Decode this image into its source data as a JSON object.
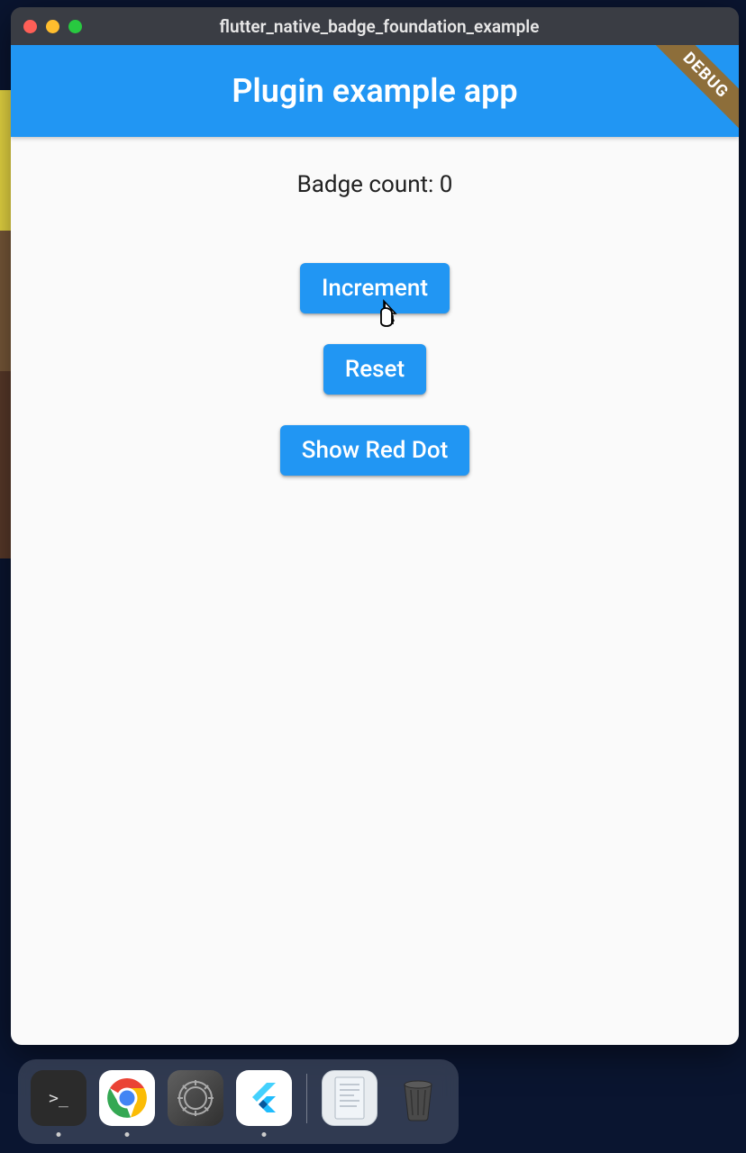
{
  "window": {
    "title": "flutter_native_badge_foundation_example"
  },
  "appbar": {
    "title": "Plugin example app",
    "debug_label": "DEBUG"
  },
  "content": {
    "badge_label": "Badge count: 0",
    "buttons": {
      "increment": "Increment",
      "reset": "Reset",
      "show_red_dot": "Show Red Dot"
    }
  },
  "dock": {
    "terminal_prompt": ">_"
  }
}
